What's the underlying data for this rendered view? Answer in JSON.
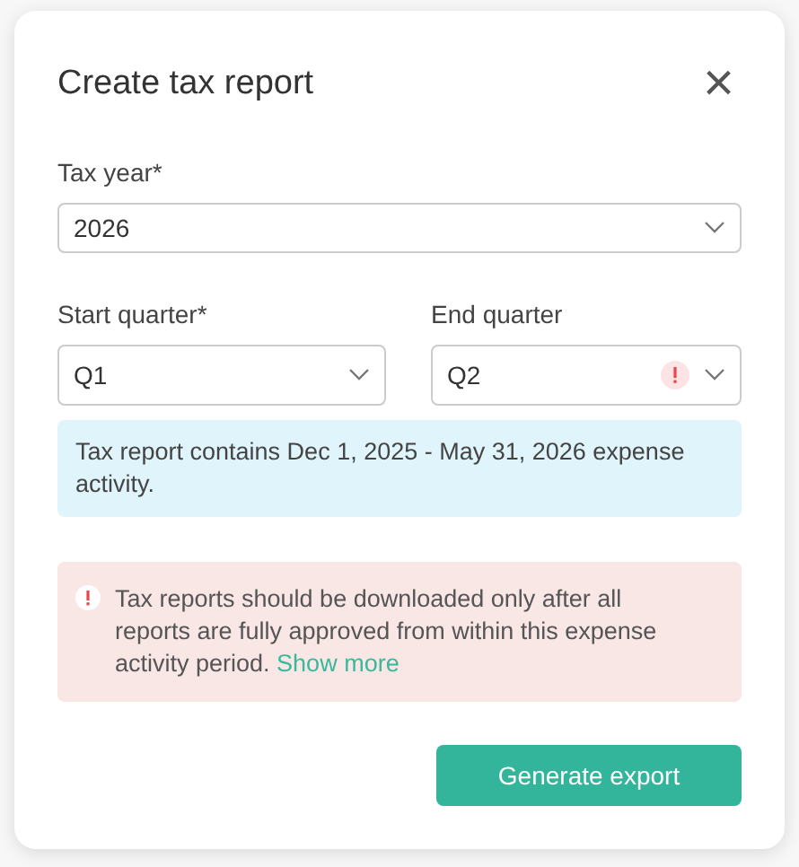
{
  "dialog": {
    "title": "Create tax report",
    "close": "×"
  },
  "tax_year": {
    "label": "Tax year*",
    "value": "2026"
  },
  "quarters": [
    {
      "label": "Start quarter*",
      "value": "Q1",
      "error": false
    },
    {
      "label": "End quarter",
      "value": "Q2",
      "error": true
    }
  ],
  "info": "Tax report contains Dec 1, 2025 - May 31, 2026 expense activity.",
  "warning": {
    "text": "Tax reports should be downloaded only after all reports are fully approved from within this expense activity period.",
    "link": "Show more"
  },
  "button": "Generate export"
}
